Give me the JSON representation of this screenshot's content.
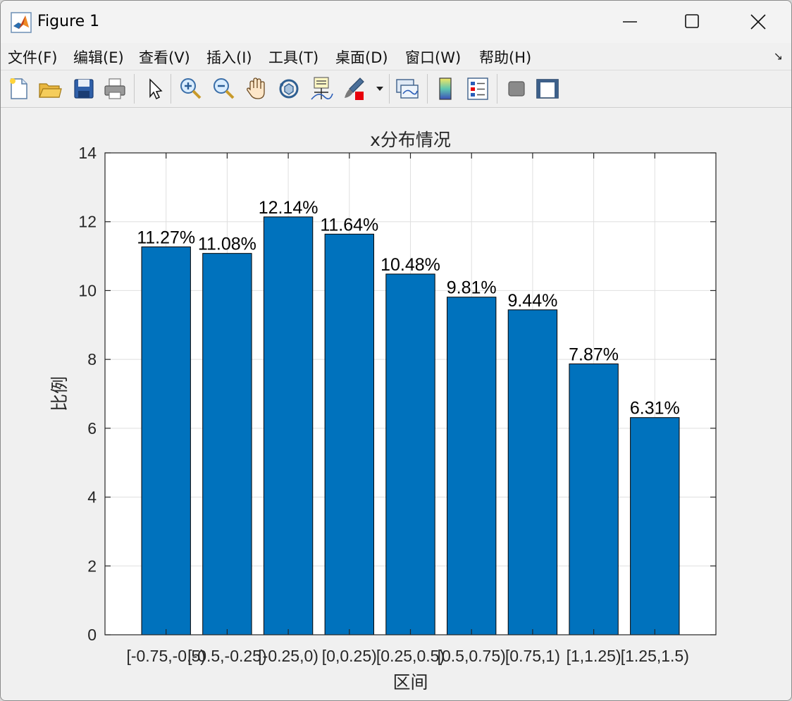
{
  "window": {
    "title": "Figure 1"
  },
  "menu": {
    "items": [
      "文件(F)",
      "编辑(E)",
      "查看(V)",
      "插入(I)",
      "工具(T)",
      "桌面(D)",
      "窗口(W)",
      "帮助(H)"
    ]
  },
  "toolbar": {
    "icons": [
      "new-figure-icon",
      "open-file-icon",
      "save-icon",
      "print-icon",
      "select-arrow-icon",
      "zoom-in-icon",
      "zoom-out-icon",
      "pan-hand-icon",
      "rotate-3d-icon",
      "data-cursor-icon",
      "brush-icon",
      "brush-dropdown-icon",
      "link-plot-icon",
      "colorbar-icon",
      "legend-icon",
      "hide-plot-tools-icon",
      "show-plot-tools-icon"
    ]
  },
  "colors": {
    "bar": "#0072BD",
    "accent_red": "#e8000b"
  },
  "chart_data": {
    "type": "bar",
    "title": "x分布情况",
    "xlabel": "区间",
    "ylabel": "比例",
    "categories": [
      "[-0.75,-0.5)",
      "[-0.5,-0.25)",
      "[-0.25,0)",
      "[0,0.25)",
      "[0.25,0.5)",
      "[0.5,0.75)",
      "[0.75,1)",
      "[1,1.25)",
      "[1.25,1.5)"
    ],
    "values": [
      11.27,
      11.08,
      12.14,
      11.64,
      10.48,
      9.81,
      9.44,
      7.87,
      6.31
    ],
    "data_labels": [
      "11.27%",
      "11.08%",
      "12.14%",
      "11.64%",
      "10.48%",
      "9.81%",
      "9.44%",
      "7.87%",
      "6.31%"
    ],
    "ylim": [
      0,
      14
    ],
    "yticks": [
      0,
      2,
      4,
      6,
      8,
      10,
      12,
      14
    ],
    "grid": true
  }
}
